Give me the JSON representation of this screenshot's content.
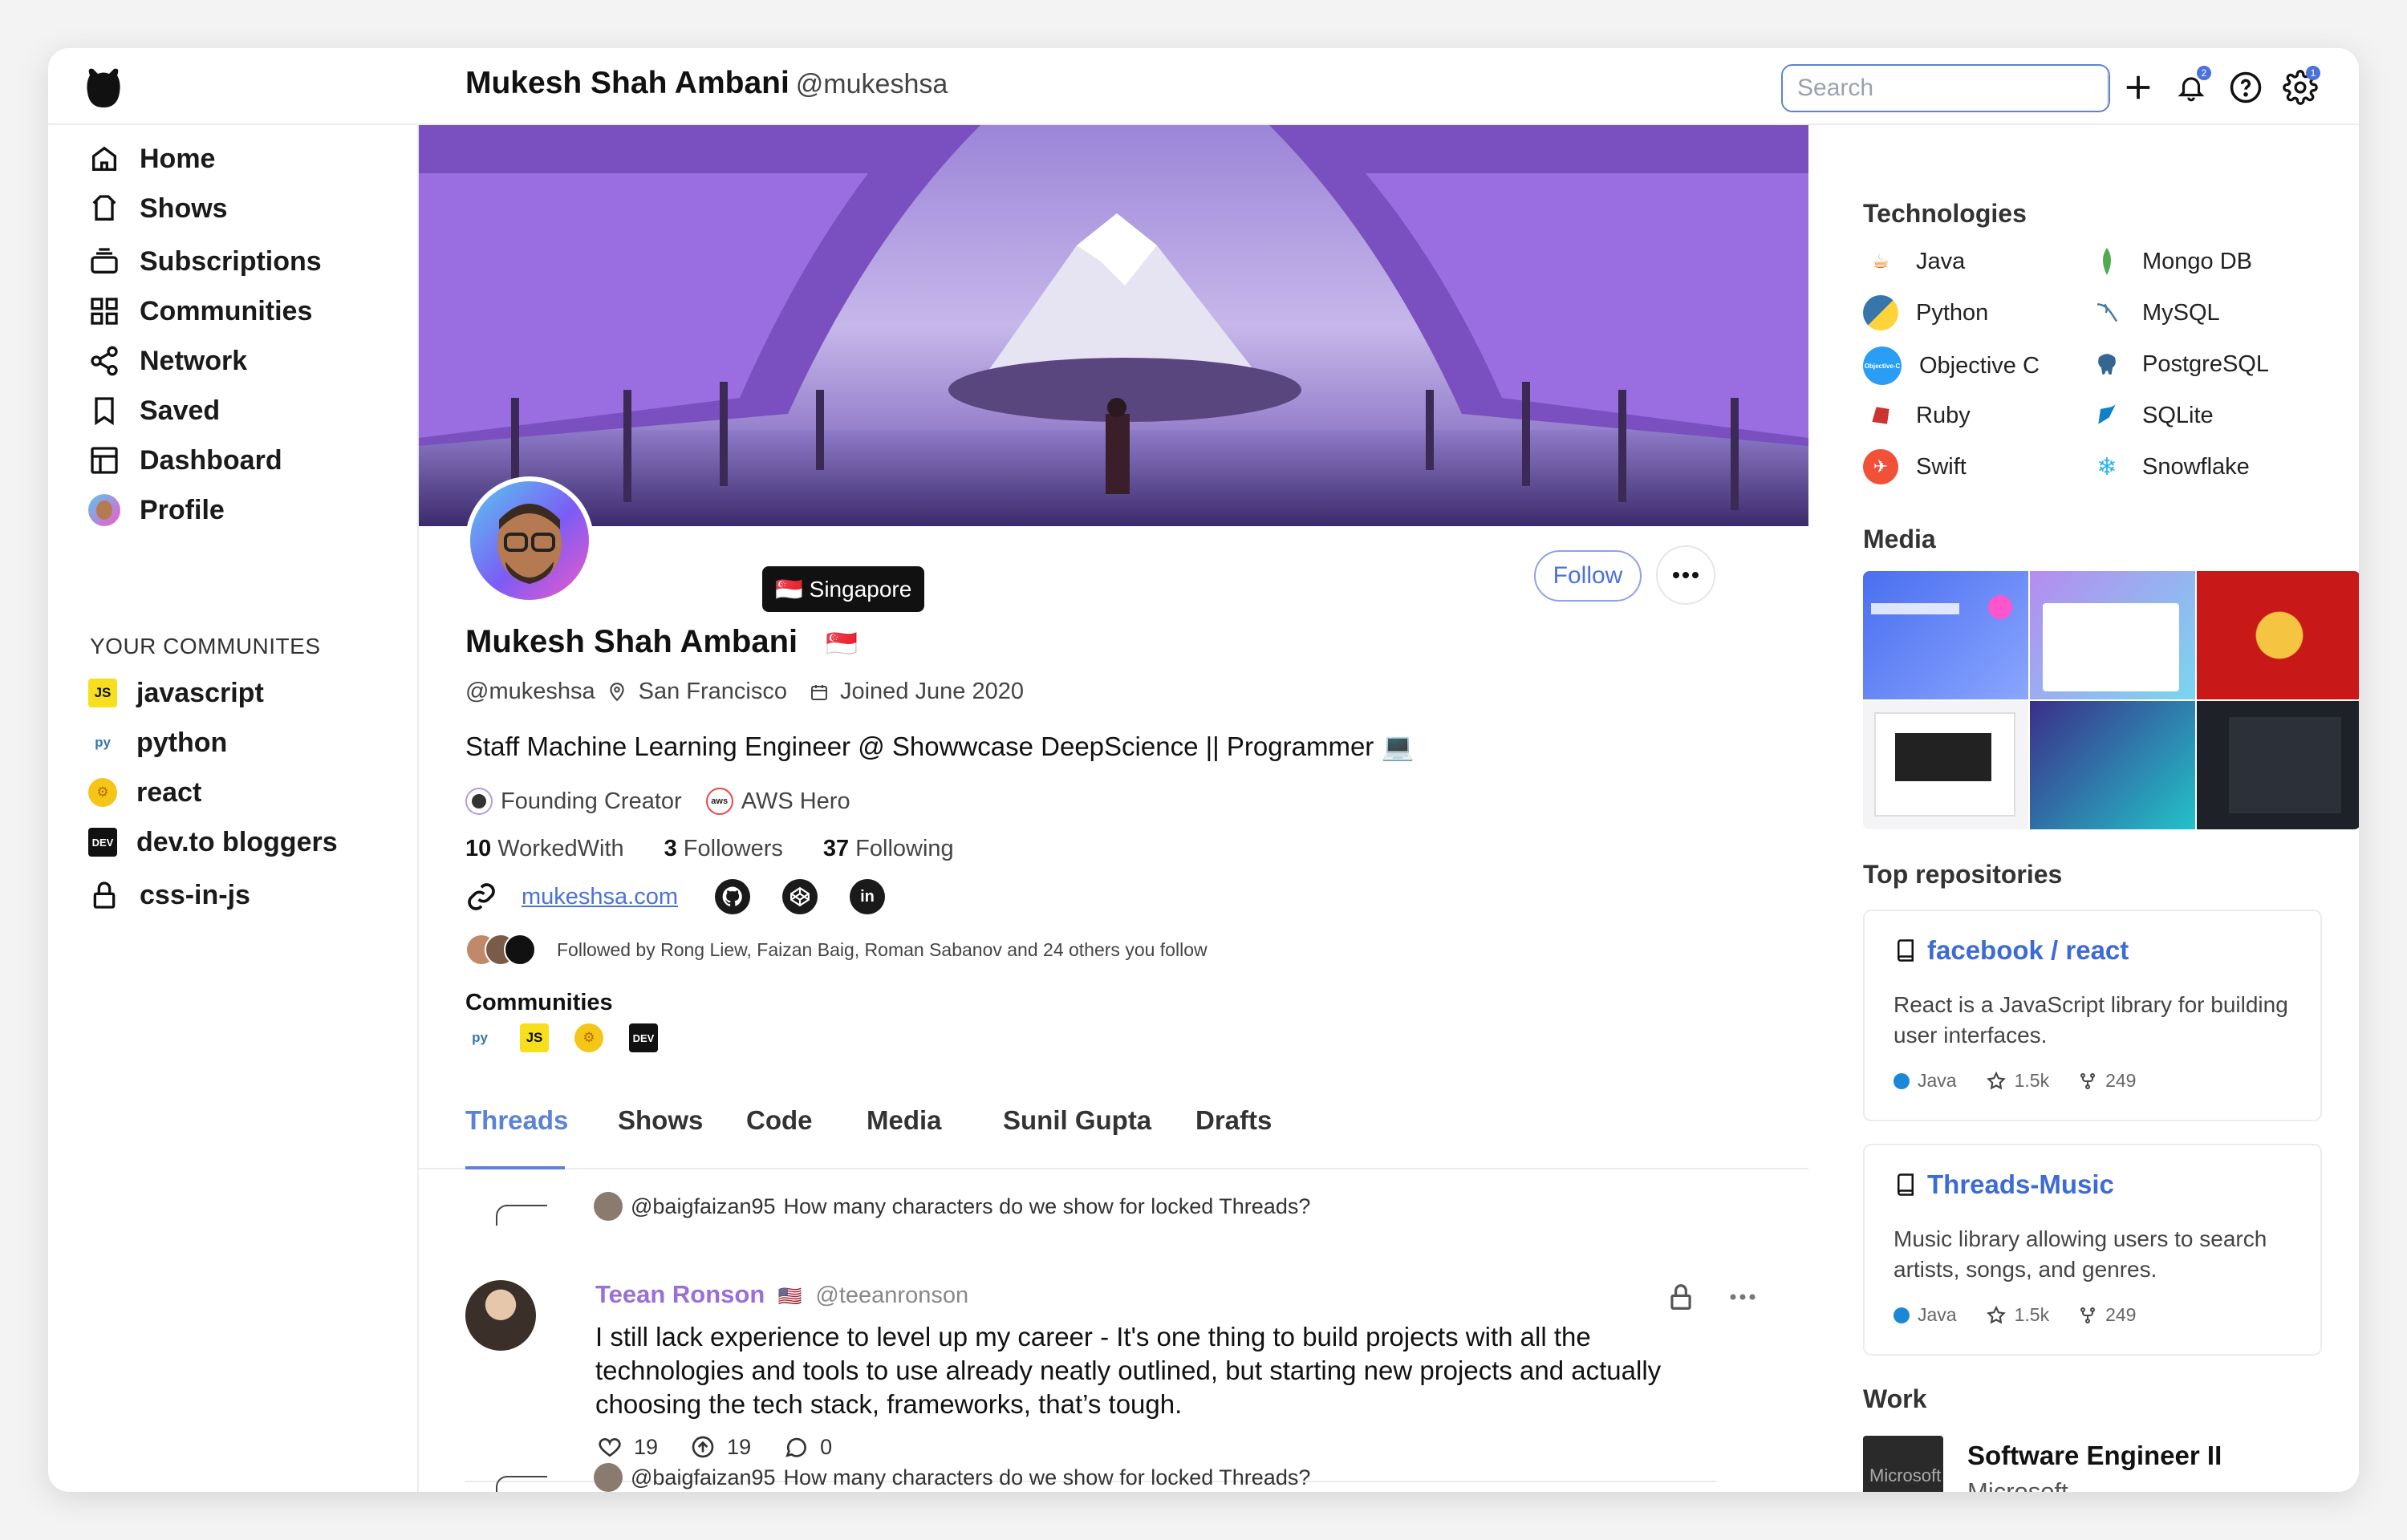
{
  "header": {
    "name": "Mukesh Shah Ambani",
    "handle": "@mukeshsa",
    "search_placeholder": "Search",
    "notification_count": "2",
    "settings_count": "1"
  },
  "sidebar": {
    "items": [
      {
        "label": "Home",
        "icon": "home-icon"
      },
      {
        "label": "Shows",
        "icon": "shows-icon"
      },
      {
        "label": "Subscriptions",
        "icon": "subscriptions-icon"
      },
      {
        "label": "Communities",
        "icon": "communities-icon"
      },
      {
        "label": "Network",
        "icon": "network-icon"
      },
      {
        "label": "Saved",
        "icon": "bookmark-icon"
      },
      {
        "label": "Dashboard",
        "icon": "dashboard-icon"
      },
      {
        "label": "Profile",
        "icon": "profile-avatar"
      }
    ],
    "communities_heading": "YOUR COMMUNITES",
    "communities": [
      {
        "label": "javascript",
        "icon": "js-icon",
        "badge": "JS"
      },
      {
        "label": "python",
        "icon": "python-icon",
        "badge": "py"
      },
      {
        "label": "react",
        "icon": "react-icon",
        "badge": "⚙"
      },
      {
        "label": "dev.to bloggers",
        "icon": "devto-icon",
        "badge": "DEV"
      },
      {
        "label": "css-in-js",
        "icon": "lock-icon",
        "badge": ""
      }
    ]
  },
  "profile": {
    "name": "Mukesh Shah Ambani",
    "flag": "🇸🇬",
    "tooltip": "Singapore",
    "tooltip_flag": "🇸🇬",
    "handle": "@mukeshsa",
    "location": "San Francisco",
    "joined": "Joined June 2020",
    "bio": "Staff Machine Learning Engineer @ Showwcase DeepScience || Programmer 💻",
    "follow_label": "Follow",
    "badges": [
      "Founding Creator",
      "AWS Hero"
    ],
    "stats": [
      {
        "value": "10",
        "label": "WorkedWith"
      },
      {
        "value": "3",
        "label": "Followers"
      },
      {
        "value": "37",
        "label": "Following"
      }
    ],
    "website": "mukeshsa.com",
    "socials": [
      "github-icon",
      "codepen-icon",
      "linkedin-icon"
    ],
    "followed_by": "Followed by Rong Liew, Faizan Baig, Roman Sabanov and 24 others you follow",
    "communities_label": "Communities",
    "community_badges": [
      "py",
      "JS",
      "⚙",
      "DEV"
    ]
  },
  "tabs": [
    "Threads",
    "Shows",
    "Code",
    "Media",
    "Sunil Gupta",
    "Drafts"
  ],
  "threads": [
    {
      "context_user": "@baigfaizan95",
      "context_text": "How many characters do we show for locked Threads?",
      "author": "Teean Ronson",
      "author_flag": "🇺🇸",
      "author_handle": "@teeanronson",
      "body": "I still lack experience to level up my career - It's one thing to build projects with all the technologies and tools to use already neatly outlined, but starting new projects and actually choosing the tech stack, frameworks, that’s tough.",
      "likes": "19",
      "boosts": "19",
      "comments": "0"
    },
    {
      "context_user": "@baigfaizan95",
      "context_text": "How many characters do we show for locked Threads?"
    }
  ],
  "right": {
    "technologies_heading": "Technologies",
    "technologies": [
      {
        "label": "Java",
        "icon": "java-icon",
        "color": "#e76f00"
      },
      {
        "label": "Mongo DB",
        "icon": "mongodb-icon",
        "color": "#4fa94d"
      },
      {
        "label": "Python",
        "icon": "python-icon",
        "color": "#3776ab"
      },
      {
        "label": "MySQL",
        "icon": "mysql-icon",
        "color": "#4479a1"
      },
      {
        "label": "Objective C",
        "icon": "objective-c-icon",
        "color": "#2a9df4"
      },
      {
        "label": "PostgreSQL",
        "icon": "postgresql-icon",
        "color": "#336791"
      },
      {
        "label": "Ruby",
        "icon": "ruby-icon",
        "color": "#cc342d"
      },
      {
        "label": "SQLite",
        "icon": "sqlite-icon",
        "color": "#0f80cc"
      },
      {
        "label": "Swift",
        "icon": "swift-icon",
        "color": "#f05138"
      },
      {
        "label": "Snowflake",
        "icon": "snowflake-icon",
        "color": "#29b5e8"
      }
    ],
    "media_heading": "Media",
    "repos_heading": "Top repositories",
    "repos": [
      {
        "title": "facebook / react",
        "desc": "React is a JavaScript library for building user interfaces.",
        "lang": "Java",
        "stars": "1.5k",
        "forks": "249"
      },
      {
        "title": "Threads-Music",
        "desc": "Music library allowing users to search artists, songs, and genres.",
        "lang": "Java",
        "stars": "1.5k",
        "forks": "249"
      }
    ],
    "work_heading": "Work",
    "work": {
      "title": "Software Engineer II",
      "company": "Microsoft",
      "logo_text": "Microsoft"
    }
  },
  "colors": {
    "accent": "#5b82d6",
    "link": "#3d6bd6",
    "author": "#9a6fd6",
    "cover": "#8a6ad0"
  }
}
